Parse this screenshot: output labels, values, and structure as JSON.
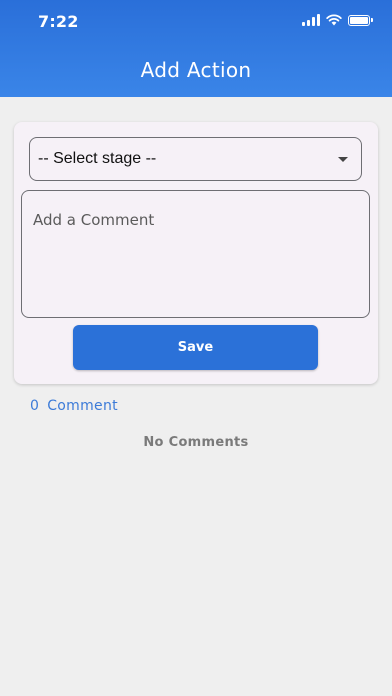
{
  "status_bar": {
    "time": "7:22",
    "icons": [
      "signal-icon",
      "wifi-icon",
      "battery-icon"
    ],
    "battery_level": 1.0
  },
  "header": {
    "title": "Add Action",
    "background_color": "#2f78e0"
  },
  "form": {
    "stage_select": {
      "selected": "-- Select stage --"
    },
    "comment": {
      "placeholder": "Add a Comment",
      "value": ""
    },
    "save_label": "Save",
    "accent_color": "#2b71d8"
  },
  "comments": {
    "count": "0",
    "label": "Comment",
    "empty_text": "No Comments"
  }
}
